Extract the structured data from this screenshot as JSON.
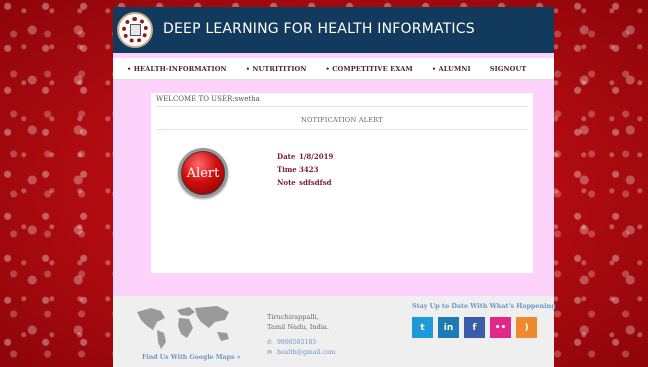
{
  "header": {
    "title": "DEEP LEARNING FOR HEALTH INFORMATICS",
    "logo_icon": "medical-people-logo-icon"
  },
  "nav": {
    "items": [
      {
        "label": "• HEALTH-INFORMATION"
      },
      {
        "label": "• NUTRITITION"
      },
      {
        "label": "• COMPETITIVE EXAM"
      },
      {
        "label": "• ALUMNI"
      },
      {
        "label": "SIGNOUT"
      }
    ]
  },
  "main": {
    "welcome": "WELCOME TO USER:swetha",
    "alert_heading": "NOTIFICATION ALERT",
    "alert_badge_text": "Alert",
    "details": {
      "date_label": "Date",
      "date_value": "1/8/2019",
      "time_label": "Time",
      "time_value": "3423",
      "note_label": "Note",
      "note_value": "sdfsdfsd"
    }
  },
  "footer": {
    "map_link": "Find Us With Google Maps »",
    "address_line1": "Tiruchirappalli,",
    "address_line2": "Tamil Nadu, India.",
    "phone": "9998585185",
    "email": "health@gmail.com",
    "stay_up": "Stay Up to Date With What's Happening",
    "social": [
      {
        "name": "twitter-icon",
        "glyph": "t",
        "color": "#1c9bd8"
      },
      {
        "name": "linkedin-icon",
        "glyph": "in",
        "color": "#1a7bb5"
      },
      {
        "name": "facebook-icon",
        "glyph": "f",
        "color": "#3b5ca8"
      },
      {
        "name": "flickr-icon",
        "glyph": "••",
        "color": "#e0288a"
      },
      {
        "name": "rss-icon",
        "glyph": "))",
        "color": "#ee8a2d"
      }
    ]
  },
  "colors": {
    "header_bg": "#123a5c",
    "content_bg": "#fdd3fb",
    "page_bg": "#b5080c",
    "accent_text": "#7a1a2e",
    "link_blue": "#6a96c5"
  }
}
